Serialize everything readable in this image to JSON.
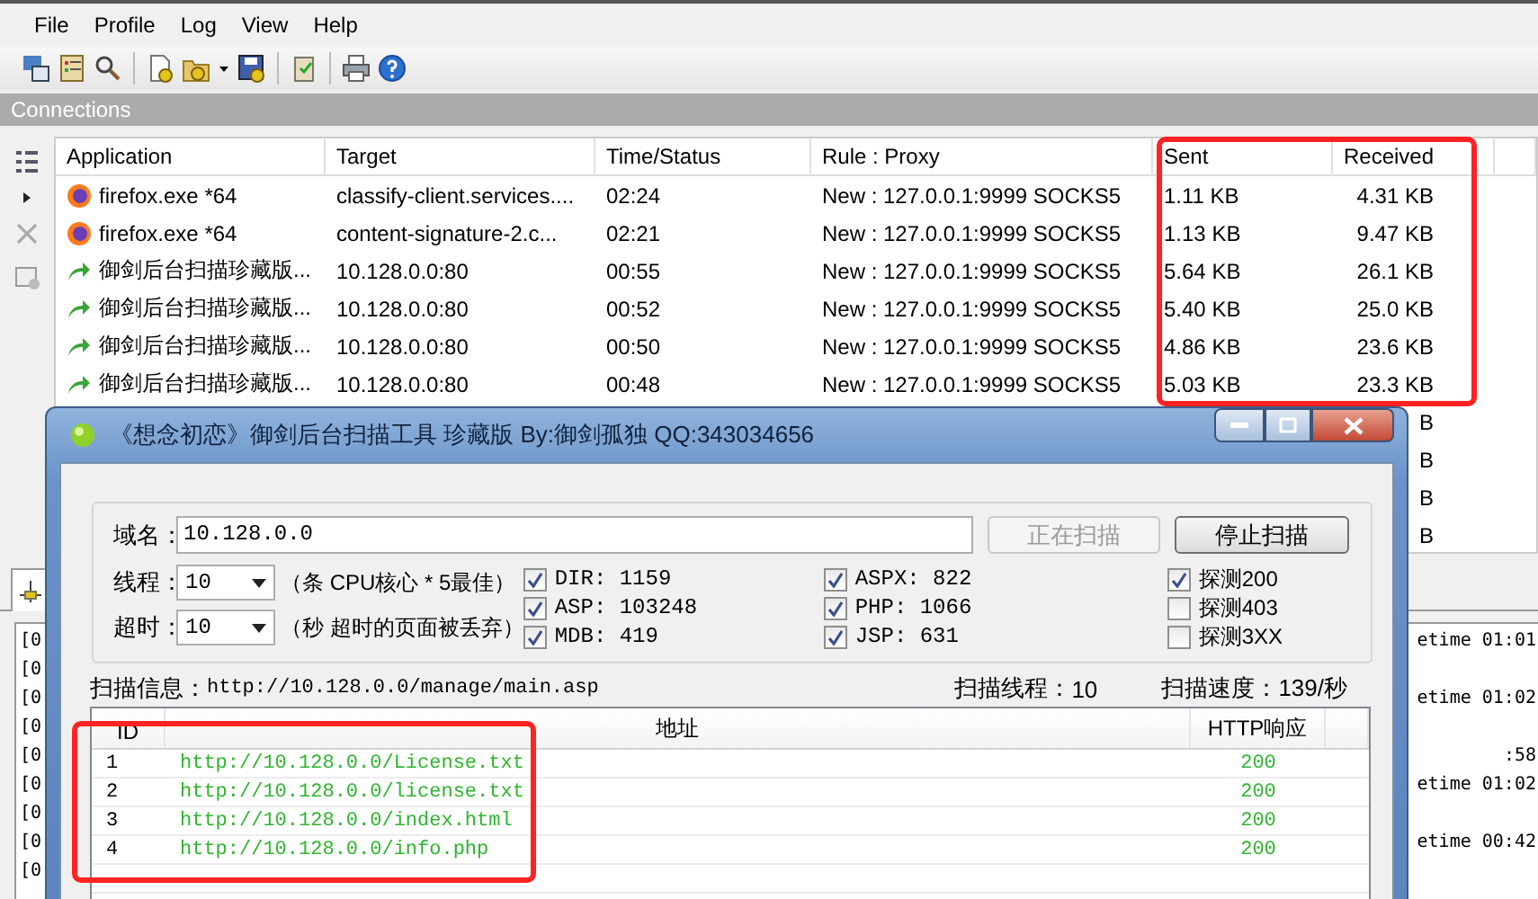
{
  "menu": [
    "File",
    "Profile",
    "Log",
    "View",
    "Help"
  ],
  "connections_title": "Connections",
  "table": {
    "columns": [
      "Application",
      "Target",
      "Time/Status",
      "Rule : Proxy",
      "Sent",
      "Received"
    ],
    "rows": [
      {
        "kind": "browser",
        "application": "firefox.exe *64",
        "target": "classify-client.services....",
        "time": "02:24",
        "rule": "New : 127.0.0.1:9999 SOCKS5",
        "sent": "1.11 KB",
        "received": "4.31 KB"
      },
      {
        "kind": "browser",
        "application": "firefox.exe *64",
        "target": "content-signature-2.c...",
        "time": "02:21",
        "rule": "New : 127.0.0.1:9999 SOCKS5",
        "sent": "1.13 KB",
        "received": "9.47 KB"
      },
      {
        "kind": "scanner",
        "application": "御剑后台扫描珍藏版...",
        "target": "10.128.0.0:80",
        "time": "00:55",
        "rule": "New : 127.0.0.1:9999 SOCKS5",
        "sent": "5.64 KB",
        "received": "26.1 KB"
      },
      {
        "kind": "scanner",
        "application": "御剑后台扫描珍藏版...",
        "target": "10.128.0.0:80",
        "time": "00:52",
        "rule": "New : 127.0.0.1:9999 SOCKS5",
        "sent": "5.40 KB",
        "received": "25.0 KB"
      },
      {
        "kind": "scanner",
        "application": "御剑后台扫描珍藏版...",
        "target": "10.128.0.0:80",
        "time": "00:50",
        "rule": "New : 127.0.0.1:9999 SOCKS5",
        "sent": "4.86 KB",
        "received": "23.6 KB"
      },
      {
        "kind": "scanner",
        "application": "御剑后台扫描珍藏版...",
        "target": "10.128.0.0:80",
        "time": "00:48",
        "rule": "New : 127.0.0.1:9999 SOCKS5",
        "sent": "5.03 KB",
        "received": "23.3 KB"
      },
      {
        "received": "B"
      },
      {
        "received": "B"
      },
      {
        "received": "B"
      },
      {
        "received": "B"
      }
    ]
  },
  "log": {
    "lines": [
      {
        "left": "[0",
        "right": "etime 01:01"
      },
      {
        "left": "[0"
      },
      {
        "left": "[0",
        "right": "etime 01:02"
      },
      {
        "left": "[0"
      },
      {
        "left": "[0",
        "right": ":58"
      },
      {
        "left": "[0",
        "right": "etime 01:02"
      },
      {
        "left": "[0"
      },
      {
        "left": "[0",
        "right": "etime 00:42"
      },
      {
        "left": "[0"
      }
    ]
  },
  "dialog": {
    "title": "《想念初恋》御剑后台扫描工具 珍藏版 By:御剑孤独 QQ:343034656",
    "domain": {
      "label": "域名：",
      "value": "10.128.0.0"
    },
    "buttons": [
      {
        "label": "正在扫描",
        "disabled": true
      },
      {
        "label": "停止扫描",
        "disabled": false
      }
    ],
    "threads": {
      "label": "线程：",
      "value": "10",
      "note": "（条 CPU核心 * 5最佳）"
    },
    "timeout": {
      "label": "超时：",
      "value": "10",
      "note": "（秒 超时的页面被丢弃）"
    },
    "dictionaries": [
      {
        "label": "DIR: 1159",
        "checked": true
      },
      {
        "label": "ASP: 103248",
        "checked": true
      },
      {
        "label": "MDB: 419",
        "checked": true
      },
      {
        "label": "ASPX: 822",
        "checked": true
      },
      {
        "label": "PHP: 1066",
        "checked": true
      },
      {
        "label": "JSP: 631",
        "checked": true
      }
    ],
    "probes": [
      {
        "label": "探测200",
        "checked": true
      },
      {
        "label": "探测403",
        "checked": false
      },
      {
        "label": "探测3XX",
        "checked": false
      }
    ],
    "scan_info": {
      "label": "扫描信息：",
      "value": "http://10.128.0.0/manage/main.asp"
    },
    "scan_threads": {
      "label": "扫描线程：",
      "value": "10"
    },
    "scan_speed": {
      "label": "扫描速度：",
      "value": "139/秒"
    },
    "results": {
      "columns": [
        "ID",
        "地址",
        "HTTP响应"
      ],
      "rows": [
        {
          "id": "1",
          "url": "http://10.128.0.0/License.txt",
          "status": "200"
        },
        {
          "id": "2",
          "url": "http://10.128.0.0/license.txt",
          "status": "200"
        },
        {
          "id": "3",
          "url": "http://10.128.0.0/index.html",
          "status": "200"
        },
        {
          "id": "4",
          "url": "http://10.128.0.0/info.php",
          "status": "200"
        }
      ]
    }
  }
}
